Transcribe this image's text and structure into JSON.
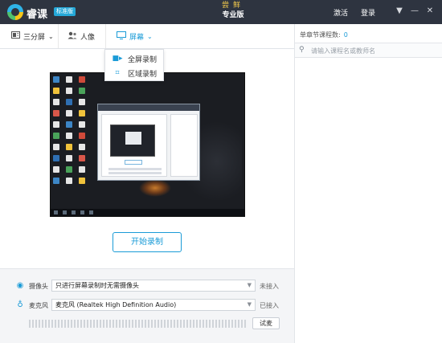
{
  "titlebar": {
    "app_name": "睿课",
    "edition_badge": "标准版",
    "promo_top": "尝鲜",
    "promo_bottom": "专业版",
    "activate": "激活",
    "login": "登录"
  },
  "toolbar": {
    "split_label": "三分屏",
    "portrait_label": "人像",
    "screen_label": "屏幕"
  },
  "screen_menu": {
    "items": [
      {
        "label": "全屏录制",
        "icon": "fullscreen-record-icon"
      },
      {
        "label": "区域录制",
        "icon": "area-record-icon"
      }
    ]
  },
  "preview": {
    "start_label": "开始录制"
  },
  "devices": {
    "camera": {
      "label": "摄像头",
      "value": "只进行屏幕录制时无需摄像头",
      "status": "未接入"
    },
    "mic": {
      "label": "麦克风",
      "value": "麦克风 (Realtek High Definition Audio)",
      "status": "已接入"
    },
    "test_label": "试麦"
  },
  "side": {
    "count_label": "单章节课程数:",
    "count_value": "0",
    "search_placeholder": "请输入课程名或教师名"
  },
  "colors": {
    "accent": "#1a9bd7",
    "titlebar": "#2e3440",
    "badge": "#24a8d8",
    "promo_gold": "#f2c94c"
  }
}
